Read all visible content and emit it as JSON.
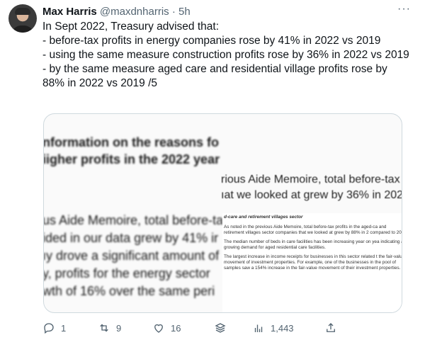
{
  "tweet": {
    "author_name": "Max Harris",
    "handle": "@maxdnharris",
    "separator": "·",
    "time": "5h",
    "more_icon": "ellipsis-icon",
    "text_lines": [
      "In Sept 2022, Treasury advised that:",
      "- before-tax profits in energy companies rose by 41% in 2022 vs 2019",
      "- using the same measure construction profits rose by 36% in 2022 vs 2019",
      "- by the same measure aged care and residential village profits rose by 88% in 2022 vs 2019 /5"
    ]
  },
  "media": {
    "back_heading_1": "nformation on the reasons fo",
    "back_heading_2": "iigher profits in the 2022 year",
    "back_line_1": "us Aide Memoire, total before-ta",
    "back_line_2": "ided in our data grew by 41% ir",
    "back_line_3": "ıy drove a significant amount of",
    "back_line_4": "y, profits for the energy sector",
    "back_line_5": "wth of 16% over the same peri",
    "mid_line_1": "rious Aide Memoire, total before-tax",
    "mid_line_2": "ıat we looked at grew by 36% in 202",
    "front_section": "d-care and retirement villages sector",
    "front_p1": "As noted in the previous Aide Memoire, total before-tax profits in the aged-ca and retirement villages sector companies that we looked at grew by 88% in 2 compared to 2019.",
    "front_p2": "The median number of beds in care facilities has been increasing year on yea indicating a growing demand for aged residential care facilities.",
    "front_p3": "The largest increase in income receipts for businesses in this sector related t the fair-value movement of investment properties. For example, one of the businesses in the pool of samples saw a 154% increase in the fair-value movement of their investment properties."
  },
  "actions": {
    "reply_count": "1",
    "retweet_count": "9",
    "like_count": "16",
    "views_count": "1,443",
    "icons": [
      "reply-icon",
      "retweet-icon",
      "like-icon",
      "stack-icon",
      "views-icon",
      "share-icon"
    ]
  },
  "colors": {
    "text": "#0f1419",
    "secondary": "#536471",
    "border": "#cfd9de"
  }
}
